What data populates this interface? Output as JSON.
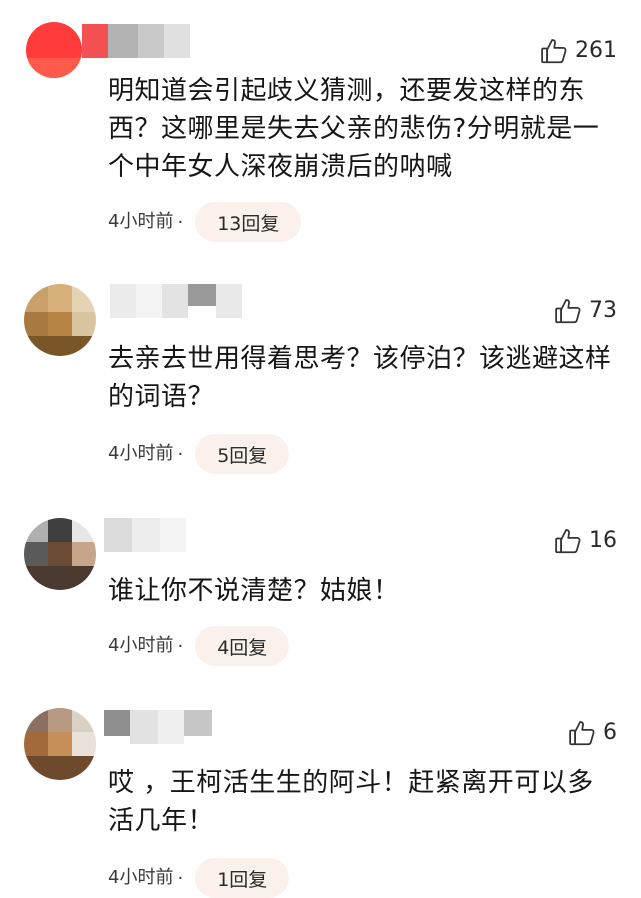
{
  "comments": [
    {
      "likes": "261",
      "text": "明知道会引起歧义猜测，还要发这样的东西？这哪里是失去父亲的悲伤?分明就是一个中年女人深夜崩溃后的呐喊",
      "time": "4小时前",
      "replies": "13回复"
    },
    {
      "likes": "73",
      "text": "去亲去世用得着思考？该停泊？该逃避这样的词语？",
      "time": "4小时前",
      "replies": "5回复"
    },
    {
      "likes": "16",
      "text": "谁让你不说清楚？姑娘！",
      "time": "4小时前",
      "replies": "4回复"
    },
    {
      "likes": "6",
      "text": "哎 ，王柯活生生的阿斗！赶紧离开可以多活几年！",
      "time": "4小时前",
      "replies": "1回复"
    }
  ],
  "icons": {
    "like": "thumbs-up-icon"
  }
}
